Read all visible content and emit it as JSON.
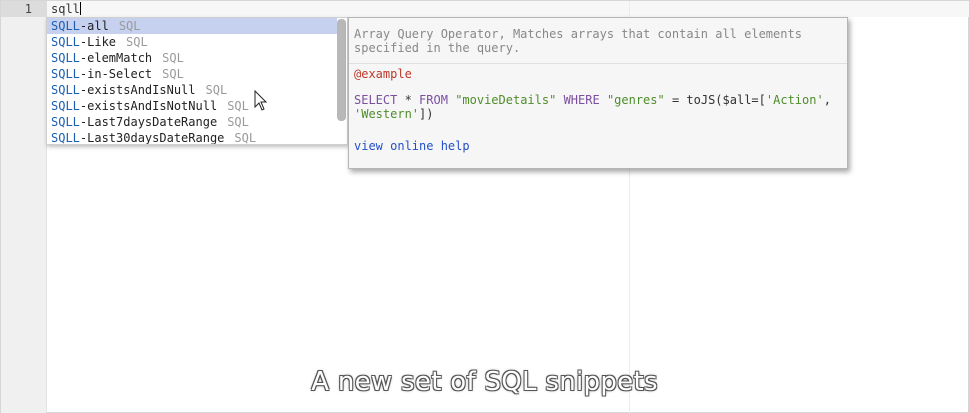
{
  "editor": {
    "line_number": "1",
    "typed_text": "sqll"
  },
  "autocomplete": {
    "items": [
      {
        "match": "SQLL",
        "rest": "-all",
        "meta": "SQL",
        "selected": true
      },
      {
        "match": "SQLL",
        "rest": "-Like",
        "meta": "SQL",
        "selected": false
      },
      {
        "match": "SQLL",
        "rest": "-elemMatch",
        "meta": "SQL",
        "selected": false
      },
      {
        "match": "SQLL",
        "rest": "-in-Select",
        "meta": "SQL",
        "selected": false
      },
      {
        "match": "SQLL",
        "rest": "-existsAndIsNull",
        "meta": "SQL",
        "selected": false
      },
      {
        "match": "SQLL",
        "rest": "-existsAndIsNotNull",
        "meta": "SQL",
        "selected": false
      },
      {
        "match": "SQLL",
        "rest": "-Last7daysDateRange",
        "meta": "SQL",
        "selected": false
      },
      {
        "match": "SQLL",
        "rest": "-Last30daysDateRange",
        "meta": "SQL",
        "selected": false
      }
    ]
  },
  "doc": {
    "description": "Array Query Operator, Matches arrays that contain all elements specified in the query.",
    "example_label": "@example",
    "code": {
      "select": "SELECT",
      "star": " * ",
      "from": "FROM",
      "table": "\"movieDetails\"",
      "where": "WHERE",
      "field": "\"genres\"",
      "expr_start": " = toJS($all=[",
      "val1": "'Action'",
      "comma": ",",
      "val2": "'Western'",
      "expr_end": "])"
    },
    "link_text": "view online help"
  },
  "caption": "A new set of SQL snippets"
}
